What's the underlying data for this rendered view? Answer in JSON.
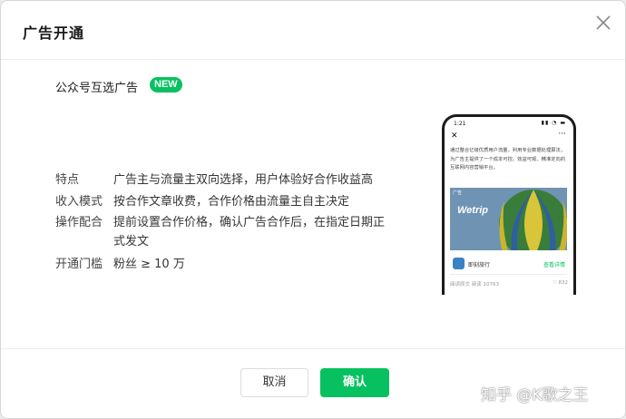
{
  "dialog": {
    "title": "广告开通",
    "close_icon": "close-icon"
  },
  "product": {
    "name": "公众号互选广告",
    "badge": "NEW",
    "badge_color": "#07c160"
  },
  "details": [
    {
      "label": "特点",
      "value": "广告主与流量主双向选择，用户体验好合作收益高"
    },
    {
      "label": "收入模式",
      "value": "按合作文章收费，合作价格由流量主自主决定"
    },
    {
      "label": "操作配合",
      "value": "提前设置合作价格，确认广告合作后，在指定日期正式发文"
    },
    {
      "label": "开通门槛",
      "value": "粉丝 ≥ 10 万"
    }
  ],
  "preview": {
    "time": "1:21",
    "article_text": "通过整合亿级优质用户流量，利用专业数据处理算法，为广告主提供了一个成本可控、效益可观、精准定向的互联网内容营销平台。",
    "ad_tag": "广告",
    "brand": "Wetrip",
    "advertiser_name": "即刻旅行",
    "cta": "查看详情",
    "read_label": "阅读原文",
    "read_stats": "阅读 10763",
    "likes": "832"
  },
  "footer": {
    "cancel_label": "取消",
    "confirm_label": "确认",
    "accent_color": "#07c160"
  },
  "watermark": "知乎 @K歌之王"
}
